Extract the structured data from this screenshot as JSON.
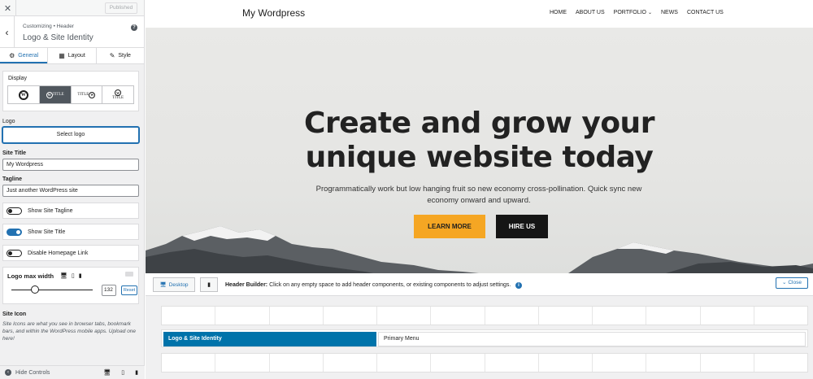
{
  "panel": {
    "published_label": "Published",
    "breadcrumb": "Customizing • Header",
    "title": "Logo & Site Identity",
    "tabs": [
      {
        "label": "General",
        "icon": "gear-icon"
      },
      {
        "label": "Layout",
        "icon": "layout-icon"
      },
      {
        "label": "Style",
        "icon": "brush-icon"
      }
    ],
    "display": {
      "label": "Display",
      "options": [
        {
          "icon": "wordpress-logo-icon",
          "text": ""
        },
        {
          "icon": "wordpress-logo-icon",
          "text": "TITLE"
        },
        {
          "icon": "wordpress-logo-icon",
          "text": "TITLE"
        },
        {
          "icon": "wordpress-logo-icon",
          "text": "TITLE"
        }
      ]
    },
    "logo": {
      "label": "Logo",
      "button": "Select logo"
    },
    "site_title": {
      "label": "Site Title",
      "value": "My Wordpress"
    },
    "tagline": {
      "label": "Tagline",
      "value": "Just another WordPress site"
    },
    "toggles": [
      {
        "label": "Show Site Tagline",
        "on": false
      },
      {
        "label": "Show Site Title",
        "on": true
      },
      {
        "label": "Disable Homepage Link",
        "on": false
      }
    ],
    "max_width": {
      "label": "Logo max width",
      "value": "132",
      "reset": "Reset"
    },
    "site_icon": {
      "label": "Site Icon",
      "description": "Site Icons are what you see in browser tabs, bookmark bars, and within the WordPress mobile apps. Upload one here!"
    },
    "footer": {
      "hide_label": "Hide Controls"
    }
  },
  "site": {
    "name": "My Wordpress",
    "nav": [
      "HOME",
      "ABOUT US",
      "PORTFOLIO",
      "NEWS",
      "CONTACT US"
    ],
    "hero": {
      "title_line1": "Create and grow your",
      "title_line2": "unique website today",
      "subtitle": "Programmatically work but low hanging fruit so new economy cross-pollination. Quick sync new economy onward and upward.",
      "btn_primary": "LEARN MORE",
      "btn_secondary": "HIRE US"
    }
  },
  "builder": {
    "desktop_label": "Desktop",
    "title_bold": "Header Builder:",
    "title_text": " Click on any empty space to add header components, or existing components to adjust settings.",
    "close_label": "Close",
    "logo_item": "Logo & Site Identity",
    "menu_item": "Primary Menu"
  },
  "colors": {
    "accent": "#2271b1",
    "builder_item": "#0073aa",
    "btn_primary": "#f5a623",
    "btn_secondary": "#151515"
  }
}
